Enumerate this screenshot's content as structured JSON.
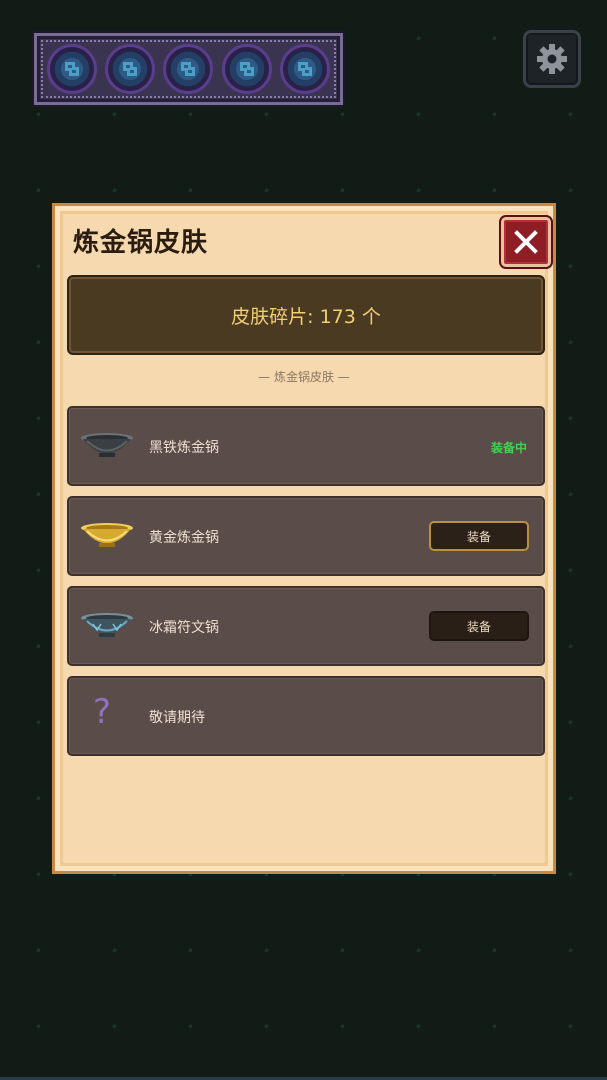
{
  "hud": {
    "rune_count": 5,
    "rune_icon": "rune-swirl-icon",
    "settings_icon": "gear-icon"
  },
  "modal": {
    "title": "炼金锅皮肤",
    "close_icon": "close-x-icon",
    "shards_text": "皮肤碎片: 173 个",
    "section_label": "— 炼金锅皮肤 —"
  },
  "skins": [
    {
      "name": "黑铁炼金锅",
      "icon": "black-iron-cauldron-icon",
      "status": "装备中"
    },
    {
      "name": "黄金炼金锅",
      "icon": "gold-cauldron-icon",
      "button": "装备"
    },
    {
      "name": "冰霜符文锅",
      "icon": "frost-rune-cauldron-icon",
      "button": "装备"
    },
    {
      "name": "敬请期待",
      "icon": "question-mark-icon",
      "placeholder_glyph": "?"
    }
  ],
  "colors": {
    "background": "#111c17",
    "panel": "#f7d9b0",
    "close_button": "#8e1d25",
    "equipped_status": "#45d04f",
    "shards_text": "#f2cf74"
  }
}
